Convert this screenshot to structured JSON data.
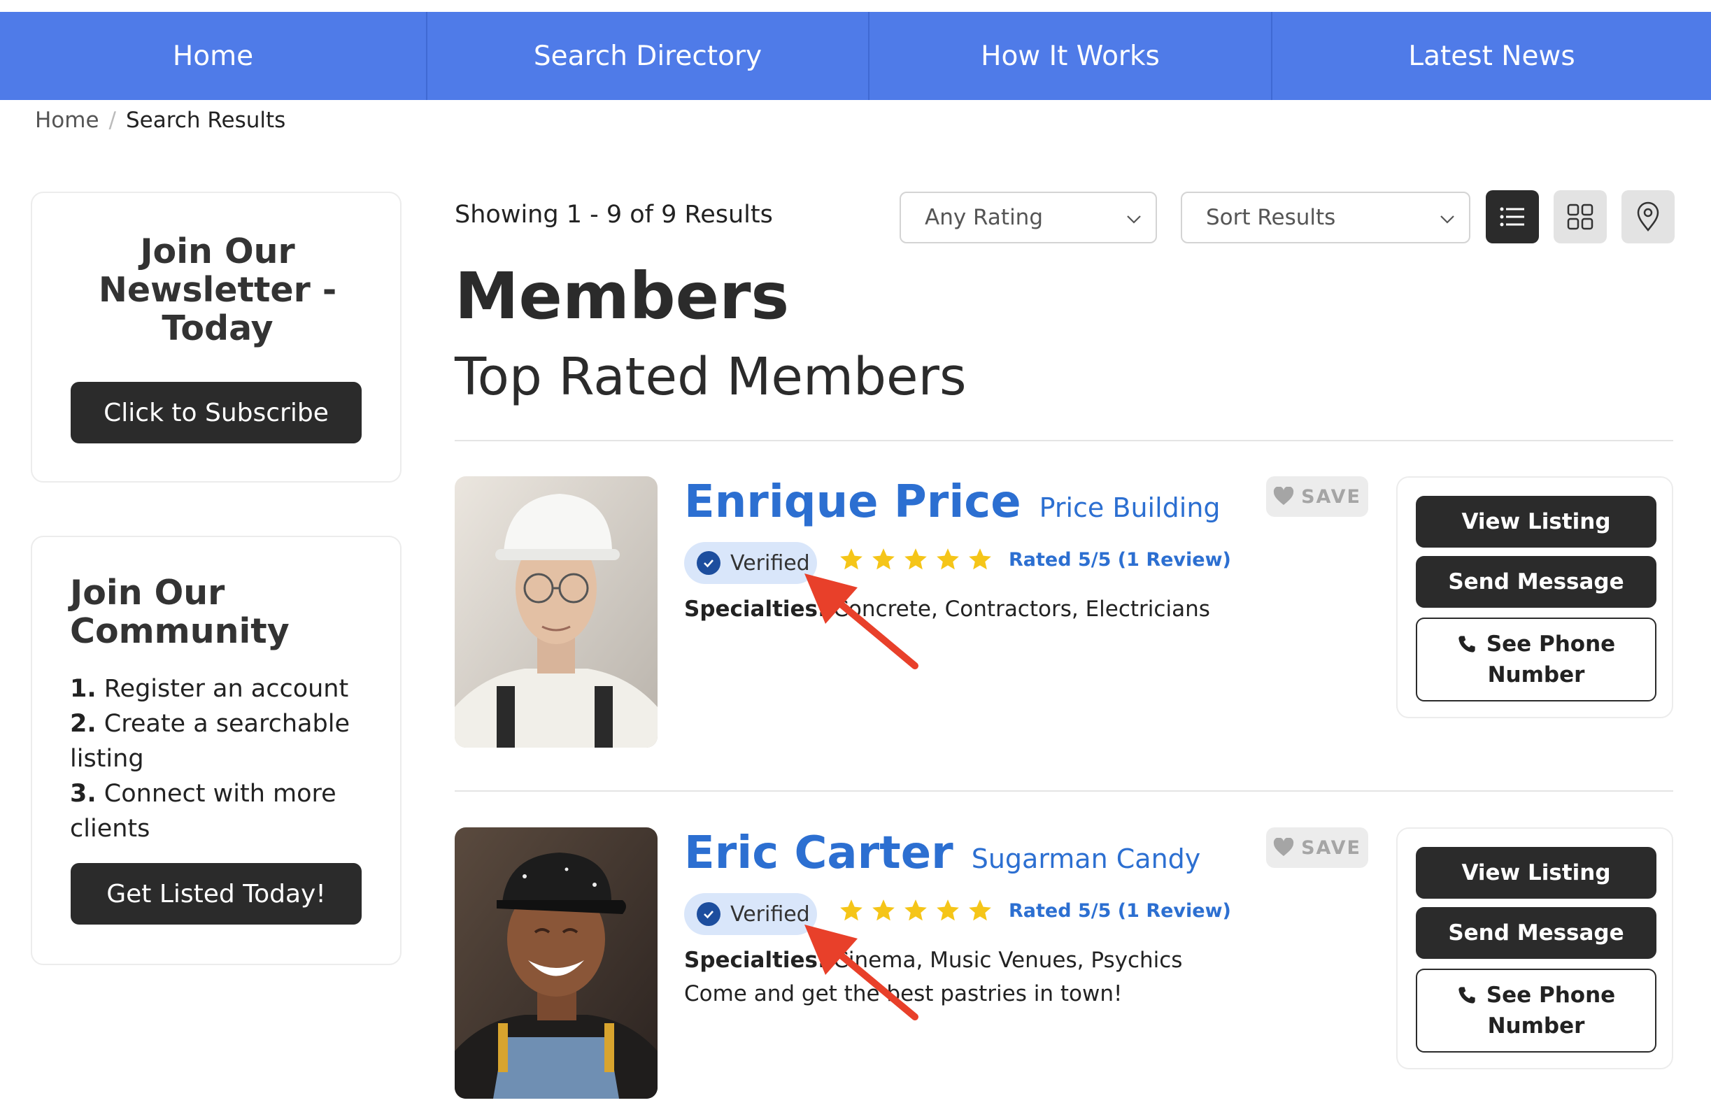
{
  "nav": {
    "items": [
      {
        "label": "Home"
      },
      {
        "label": "Search Directory"
      },
      {
        "label": "How It Works"
      },
      {
        "label": "Latest News"
      }
    ]
  },
  "breadcrumb": {
    "home": "Home",
    "separator": "/",
    "current": "Search Results"
  },
  "sidebar": {
    "newsletter": {
      "title": "Join Our Newsletter - Today",
      "button": "Click to Subscribe"
    },
    "community": {
      "title": "Join Our Community",
      "steps": [
        {
          "num": "1.",
          "text": "Register an account"
        },
        {
          "num": "2.",
          "text": "Create a searchable listing"
        },
        {
          "num": "3.",
          "text": "Connect with more clients"
        }
      ],
      "button": "Get Listed Today!"
    }
  },
  "results": {
    "showing": "Showing 1 - 9 of 9 Results",
    "rating_filter": "Any Rating",
    "sort": "Sort Results",
    "view_modes": [
      "list-view-icon",
      "grid-view-icon",
      "map-view-icon"
    ],
    "active_view": "list"
  },
  "page": {
    "title": "Members",
    "subtitle": "Top Rated Members"
  },
  "listings": [
    {
      "name": "Enrique Price",
      "company": "Price Building",
      "verified": "Verified",
      "stars": 5,
      "rating_text": "Rated 5/5 (1 Review)",
      "specialties_label": "Specialties:",
      "specialties": "Concrete, Contractors, Electricians",
      "tagline": "",
      "save": "SAVE",
      "view_listing": "View Listing",
      "send_message": "Send Message",
      "see_phone_line1": "See Phone",
      "see_phone_line2": "Number"
    },
    {
      "name": "Eric Carter",
      "company": "Sugarman Candy",
      "verified": "Verified",
      "stars": 5,
      "rating_text": "Rated 5/5 (1 Review)",
      "specialties_label": "Specialties:",
      "specialties": "Cinema, Music Venues, Psychics",
      "tagline": "Come and get the best pastries in town!",
      "save": "SAVE",
      "view_listing": "View Listing",
      "send_message": "Send Message",
      "see_phone_line1": "See Phone",
      "see_phone_line2": "Number"
    }
  ],
  "colors": {
    "nav_bg": "#4f7be8",
    "link_blue": "#2c6fd1",
    "verified_bg": "#d9e6fa",
    "star": "#f5c518",
    "dark_button": "#2b2b2b",
    "annotation_arrow": "#e8402a"
  }
}
